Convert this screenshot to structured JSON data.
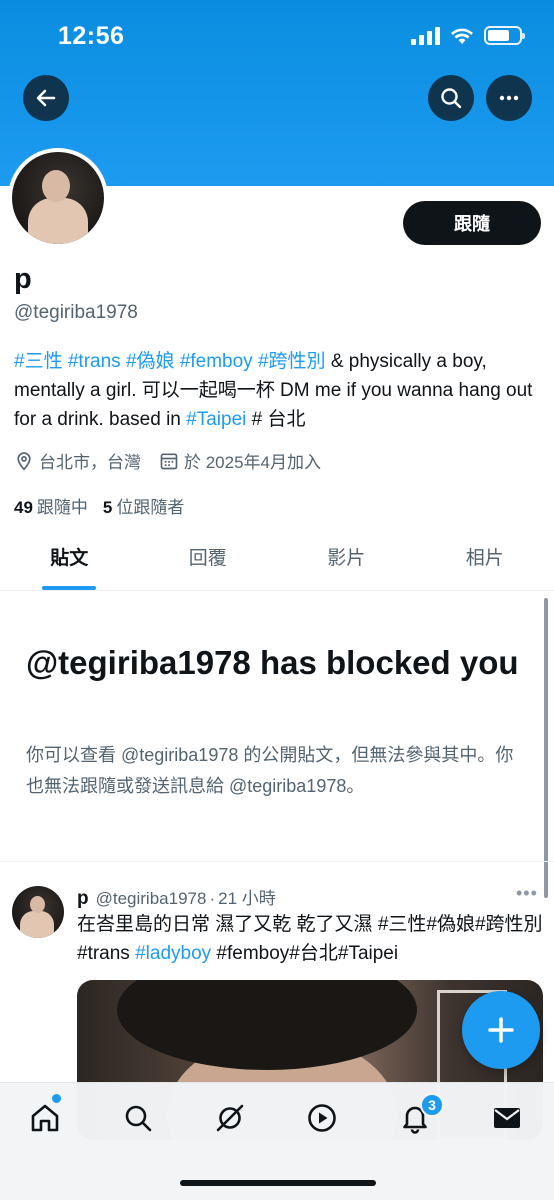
{
  "status_bar": {
    "time": "12:56"
  },
  "profile": {
    "follow_button": "跟隨",
    "name": "p",
    "handle": "@tegiriba1978",
    "bio": [
      {
        "text": "#三性",
        "tag": true
      },
      {
        "text": " ",
        "tag": false
      },
      {
        "text": "#trans",
        "tag": true
      },
      {
        "text": " ",
        "tag": false
      },
      {
        "text": "#偽娘",
        "tag": true
      },
      {
        "text": " ",
        "tag": false
      },
      {
        "text": "#femboy",
        "tag": true
      },
      {
        "text": " ",
        "tag": false
      },
      {
        "text": "#跨性別",
        "tag": true
      },
      {
        "text": " & physically a boy, mentally a girl. 可以一起喝一杯 DM me if you wanna hang out for a drink. based in ",
        "tag": false
      },
      {
        "text": "#Taipei",
        "tag": true
      },
      {
        "text": " # 台北",
        "tag": false
      }
    ],
    "location": "台北市，台灣",
    "joined": "於 2025年4月加入",
    "following_count": "49",
    "following_label": "跟隨中",
    "followers_count": "5",
    "followers_label": "位跟隨者"
  },
  "tabs": [
    {
      "label": "貼文",
      "active": true
    },
    {
      "label": "回覆",
      "active": false
    },
    {
      "label": "影片",
      "active": false
    },
    {
      "label": "相片",
      "active": false
    }
  ],
  "blocked": {
    "title": "@tegiriba1978 has blocked you",
    "message": "你可以查看 @tegiriba1978 的公開貼文，但無法參與其中。你也無法跟隨或發送訊息給 @tegiriba1978。"
  },
  "post": {
    "name": "p",
    "handle": "@tegiriba1978",
    "separator": "·",
    "time": "21 小時",
    "more": "•••",
    "text": [
      {
        "text": "在峇里島的日常 濕了又乾 乾了又濕 #三性#偽娘#跨性別#trans ",
        "tag": false
      },
      {
        "text": "#ladyboy",
        "tag": true
      },
      {
        "text": " #femboy#台北#Taipei",
        "tag": false
      }
    ]
  },
  "bottom_nav": {
    "items": [
      "home-icon",
      "search-icon",
      "grok-icon",
      "video-icon",
      "notifications-icon",
      "messages-icon"
    ],
    "notification_badge": "3"
  },
  "colors": {
    "accent": "#1d9bf0",
    "text": "#0f1419",
    "secondary": "#536471"
  }
}
